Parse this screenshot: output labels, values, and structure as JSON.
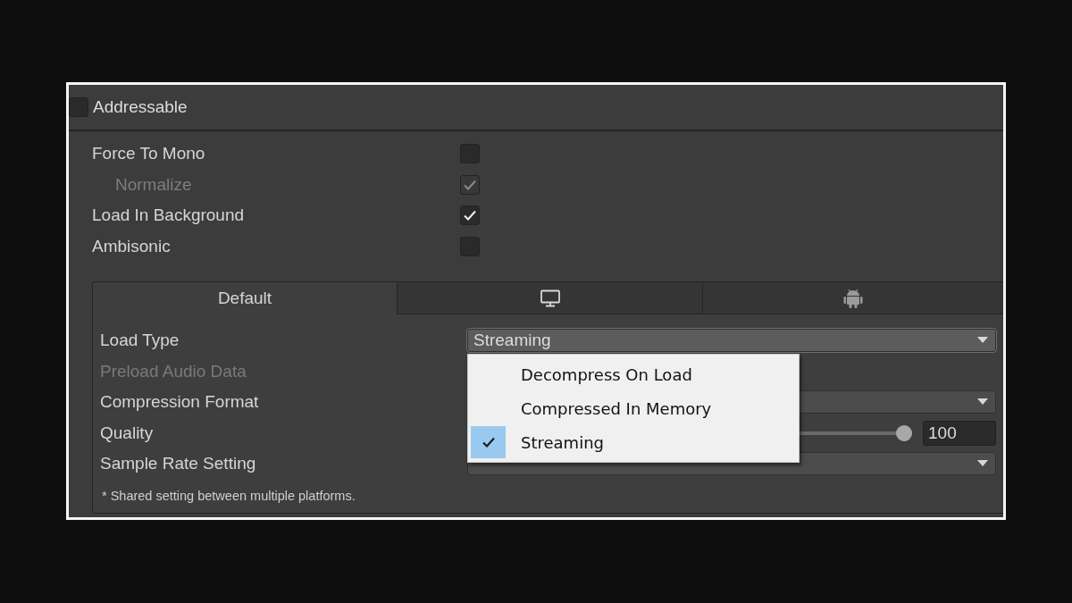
{
  "addressable": {
    "label": "Addressable",
    "checked": false
  },
  "options": [
    {
      "label": "Force To Mono",
      "checked": false,
      "disabled": false,
      "children": [
        {
          "label": "Normalize",
          "checked": true,
          "disabled": true
        }
      ]
    },
    {
      "label": "Load In Background",
      "checked": true,
      "disabled": false
    },
    {
      "label": "Ambisonic",
      "checked": false,
      "disabled": false
    }
  ],
  "platform_tabs": [
    {
      "kind": "text",
      "label": "Default",
      "selected": true
    },
    {
      "kind": "desktop",
      "selected": false
    },
    {
      "kind": "android",
      "selected": false
    }
  ],
  "settings": [
    {
      "kind": "dropdown",
      "label": "Load Type",
      "value": "Streaming",
      "disabled": false,
      "expanded": true
    },
    {
      "kind": "label",
      "label": "Preload Audio Data",
      "disabled": true
    },
    {
      "kind": "dropdown",
      "label": "Compression Format",
      "disabled": false,
      "expanded": false
    },
    {
      "kind": "slider",
      "label": "Quality",
      "disabled": false,
      "level": 1,
      "value": "100"
    },
    {
      "kind": "dropdown",
      "label": "Sample Rate Setting",
      "disabled": false,
      "expanded": false
    }
  ],
  "menu": {
    "items": [
      {
        "label": "Decompress On Load",
        "selected": false
      },
      {
        "label": "Compressed In Memory",
        "selected": false
      },
      {
        "label": "Streaming",
        "selected": true
      }
    ]
  },
  "footnote": "* Shared setting between multiple platforms."
}
